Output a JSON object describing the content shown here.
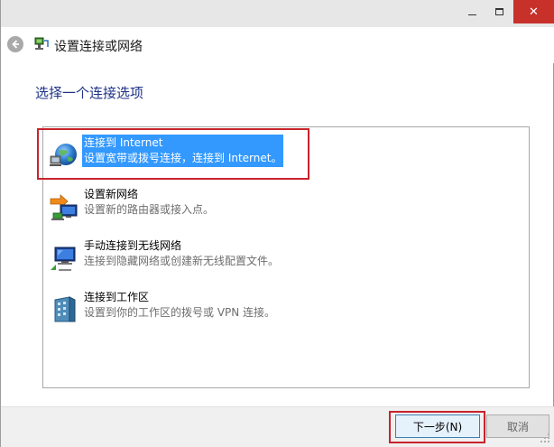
{
  "window": {
    "title": "设置连接或网络",
    "controls": {
      "minimize": "—",
      "maximize": "□",
      "close": "✕"
    }
  },
  "heading": "选择一个连接选项",
  "options": [
    {
      "title": "连接到 Internet",
      "desc": "设置宽带或拨号连接，连接到 Internet。",
      "icon": "globe-network-icon",
      "selected": true
    },
    {
      "title": "设置新网络",
      "desc": "设置新的路由器或接入点。",
      "icon": "router-setup-icon",
      "selected": false
    },
    {
      "title": "手动连接到无线网络",
      "desc": "连接到隐藏网络或创建新无线配置文件。",
      "icon": "wireless-network-icon",
      "selected": false
    },
    {
      "title": "连接到工作区",
      "desc": "设置到你的工作区的拨号或 VPN 连接。",
      "icon": "workplace-building-icon",
      "selected": false
    }
  ],
  "buttons": {
    "next": "下一步(N)",
    "cancel": "取消"
  },
  "colors": {
    "selection": "#3399ff",
    "highlight_outline": "#c8232c",
    "heading": "#1e3287",
    "close_button": "#c7312a"
  }
}
